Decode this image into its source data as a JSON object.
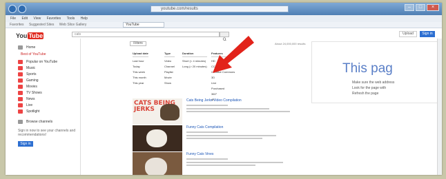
{
  "browser": {
    "address": "youtube.com/results",
    "tab_label": "YouTube",
    "menu": [
      "File",
      "Edit",
      "View",
      "Favorites",
      "Tools",
      "Help"
    ],
    "favorites": [
      "Favorites",
      "Suggested Sites",
      "Web Slice Gallery"
    ],
    "window_buttons": [
      "–",
      "□",
      "×"
    ]
  },
  "youtube": {
    "logo": "You",
    "logo_tube": "Tube",
    "search_query": "cats",
    "upload_label": "Upload",
    "signin_label": "Sign in",
    "filter_label": "Filters",
    "results_count": "About 24,000,000 results"
  },
  "sidebar": {
    "home": "Home",
    "section_title": "Best of YouTube",
    "items": [
      "Popular on YouTube",
      "Music",
      "Sports",
      "Gaming",
      "Movies",
      "TV Shows",
      "News",
      "Live",
      "Spotlight"
    ],
    "browse_link": "Browse channels",
    "note": "Sign in now to see your channels and recommendations!",
    "signin_label": "Sign in"
  },
  "filters": [
    {
      "head": "Upload date",
      "items": [
        "Last hour",
        "Today",
        "This week",
        "This month",
        "This year"
      ]
    },
    {
      "head": "Type",
      "items": [
        "Video",
        "Channel",
        "Playlist",
        "Movie",
        "Show"
      ]
    },
    {
      "head": "Duration",
      "items": [
        "Short (< 4 minutes)",
        "Long (> 20 minutes)"
      ]
    },
    {
      "head": "Features",
      "items": [
        "HD",
        "CC",
        "Creative Commons",
        "3D",
        "Live",
        "Purchased",
        "360°",
        "4K"
      ]
    }
  ],
  "results": [
    {
      "title": "Cats Being Jerks Video Compilation",
      "thumb_text": "CATS BEING JERKS"
    },
    {
      "title": "Funny Cats Compilation",
      "thumb_text": ""
    },
    {
      "title": "Funny Cats Vines",
      "thumb_text": ""
    }
  ],
  "ad": {
    "title": "This pag",
    "lines": [
      "Make sure the web address",
      "Look for the page with",
      "Refresh the page"
    ]
  },
  "colors": {
    "youtube_red": "#e02b20",
    "link_blue": "#1a54b6",
    "annotation_arrow": "#e2231a",
    "signin_blue": "#2d6fd1"
  },
  "annotation": {
    "icon": "red-arrow-icon",
    "target": "filters-features"
  }
}
